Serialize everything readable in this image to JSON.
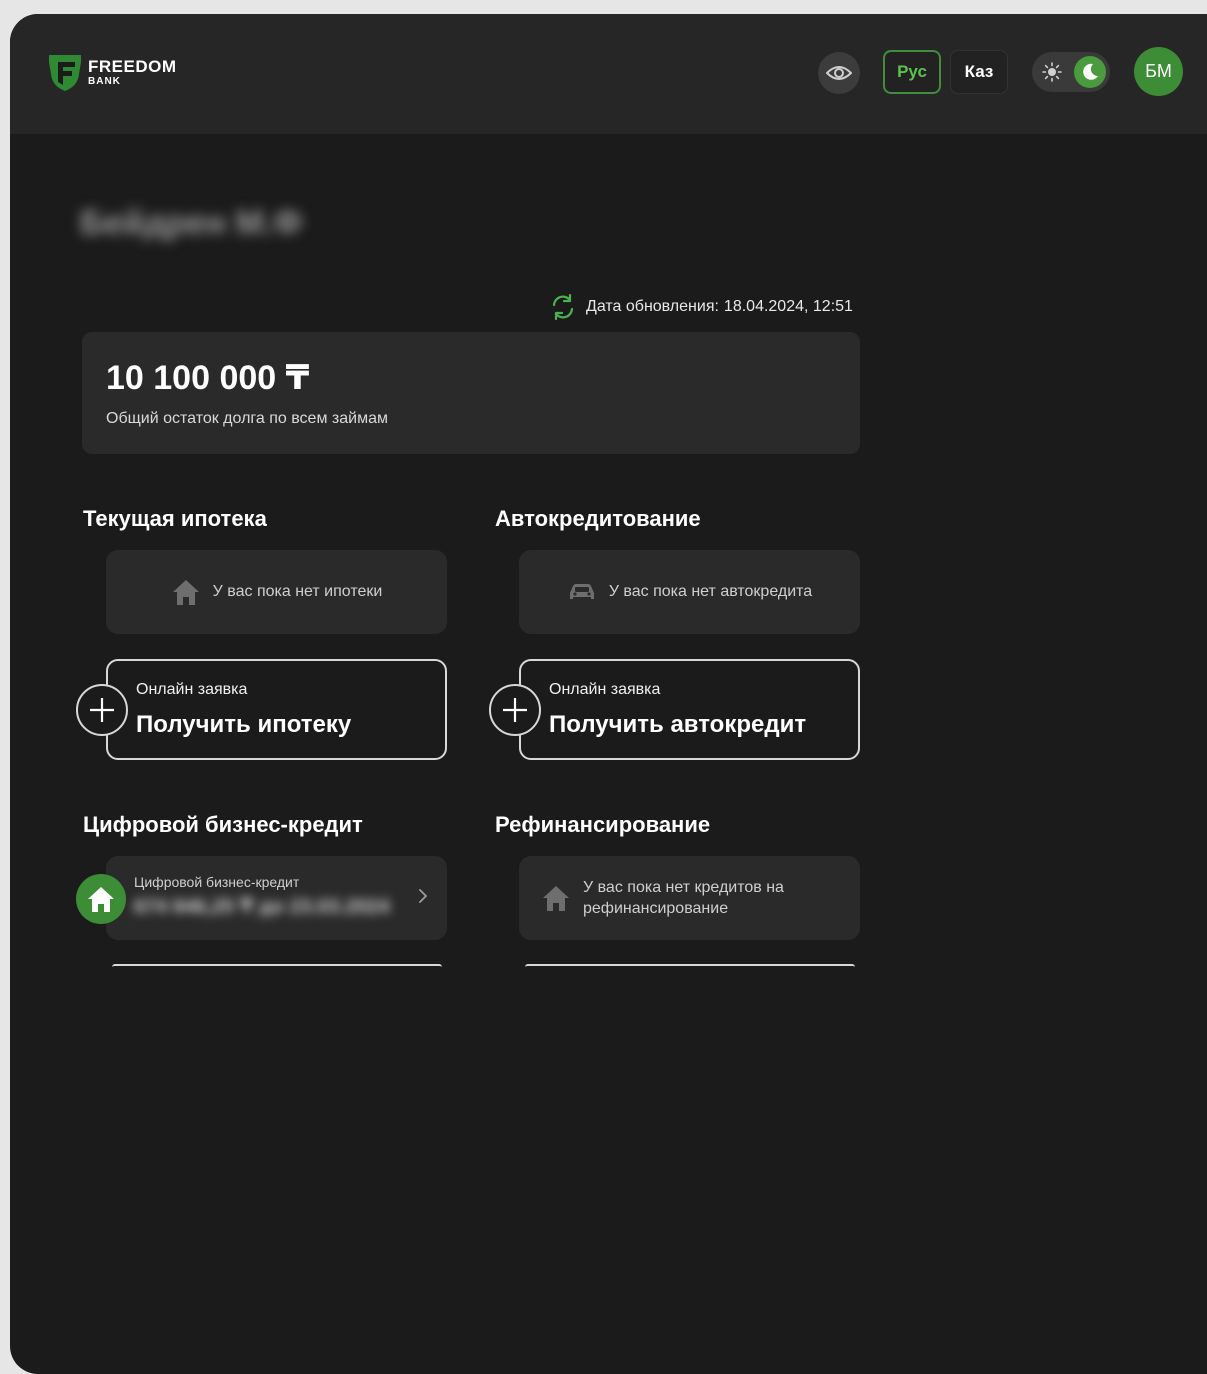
{
  "header": {
    "logo": {
      "line1": "FREEDOM",
      "line2": "BANK",
      "icon": "freedom-logo-icon"
    },
    "visibility_icon": "eye-icon",
    "languages": [
      {
        "label": "Рус",
        "active": true
      },
      {
        "label": "Каз",
        "active": false
      }
    ],
    "theme": {
      "mode": "dark",
      "sun_icon": "sun-icon",
      "moon_icon": "moon-icon"
    },
    "avatar_initials": "БМ"
  },
  "colors": {
    "accent_green": "#4a9b3e",
    "background": "#1b1b1b",
    "card": "#2a2a2a",
    "header": "#262626"
  },
  "user": {
    "name": "Бейдрен М.Ф"
  },
  "update": {
    "label": "Дата обновления:",
    "value": "18.04.2024, 12:51"
  },
  "total": {
    "amount": "10 100 000 ₸",
    "label": "Общий остаток долга по всем займам"
  },
  "mortgage": {
    "title": "Текущая ипотека",
    "empty_text": "У вас пока нет ипотеки",
    "apply_small": "Онлайн заявка",
    "apply_big": "Получить ипотеку"
  },
  "auto": {
    "title": "Автокредитование",
    "empty_text": "У вас пока нет автокредита",
    "apply_small": "Онлайн заявка",
    "apply_big": "Получить автокредит"
  },
  "business": {
    "title": "Цифровой бизнес-кредит",
    "item_label": "Цифровой бизнес-кредит",
    "item_amount": "674 846,25 ₸ до 23.03.2024"
  },
  "refinance": {
    "title": "Рефинансирование",
    "empty_line1": "У вас пока нет кредитов на",
    "empty_line2": "рефинансирование"
  }
}
